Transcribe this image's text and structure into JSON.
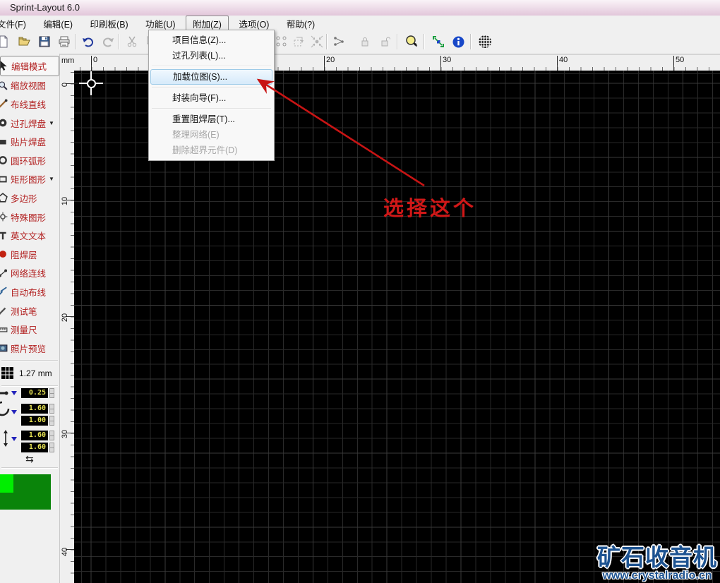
{
  "window": {
    "title": "Sprint-Layout 6.0"
  },
  "menubar": {
    "items": [
      {
        "label": "文件(F)"
      },
      {
        "label": "编辑(E)"
      },
      {
        "label": "印刷板(B)"
      },
      {
        "label": "功能(U)"
      },
      {
        "label": "附加(Z)",
        "active": true
      },
      {
        "label": "选项(O)"
      },
      {
        "label": "帮助(?)"
      }
    ]
  },
  "toolbar": {
    "icons": [
      "new-document",
      "open",
      "save",
      "print",
      "undo",
      "redo",
      "cut",
      "copy",
      "group",
      "rotate",
      "converge",
      "connect",
      "lock",
      "unlock",
      "zoom",
      "snap",
      "info",
      "raster"
    ]
  },
  "dropdown": {
    "items": [
      {
        "label": "项目信息(Z)...",
        "state": "normal"
      },
      {
        "label": "过孔列表(L)...",
        "state": "normal"
      },
      {
        "label": "加载位图(S)...",
        "state": "highlighted"
      },
      {
        "label": "封装向导(F)...",
        "state": "normal"
      },
      {
        "label": "重置阻焊层(T)...",
        "state": "normal"
      },
      {
        "label": "整理网络(E)",
        "state": "disabled"
      },
      {
        "label": "删除超界元件(D)",
        "state": "disabled"
      }
    ]
  },
  "sidebar": {
    "tools": [
      {
        "label": "编辑模式",
        "selected": true
      },
      {
        "label": "缩放视图"
      },
      {
        "label": "布线直线"
      },
      {
        "label": "过孔焊盘",
        "dropdown": true
      },
      {
        "label": "贴片焊盘"
      },
      {
        "label": "圆环弧形"
      },
      {
        "label": "矩形图形",
        "dropdown": true
      },
      {
        "label": "多边形"
      },
      {
        "label": "特殊图形"
      },
      {
        "label": "英文文本"
      },
      {
        "label": "阻焊层"
      },
      {
        "label": "网络连线"
      },
      {
        "label": "自动布线"
      },
      {
        "label": "测试笔"
      },
      {
        "label": "测量尺"
      },
      {
        "label": "照片预览"
      }
    ],
    "dropdown_glyph": "▼",
    "grid_value": "1.27 mm",
    "values": {
      "track_width": "0.25",
      "pad_outer": "1.60",
      "pad_inner": "1.00",
      "smd_width": "1.60",
      "smd_height": "1.60"
    },
    "swap_glyph": "⇆"
  },
  "rulers": {
    "unit": "mm",
    "h": [
      "0",
      "10",
      "20",
      "30",
      "40",
      "50"
    ],
    "v": [
      "0",
      "10",
      "20",
      "30",
      "40"
    ]
  },
  "annotation": {
    "text": "选择这个"
  },
  "watermark": {
    "title": "矿石收音机",
    "url": "www.crystalradio.cn"
  },
  "colors": {
    "annotation_red": "#d01818",
    "canvas_bg": "#000000",
    "grid_line": "#292929",
    "value_text": "#e6e254",
    "watermark_blue": "#1d5391",
    "menu_highlight": "#d6eafa",
    "sidebar_text": "#b22020"
  }
}
